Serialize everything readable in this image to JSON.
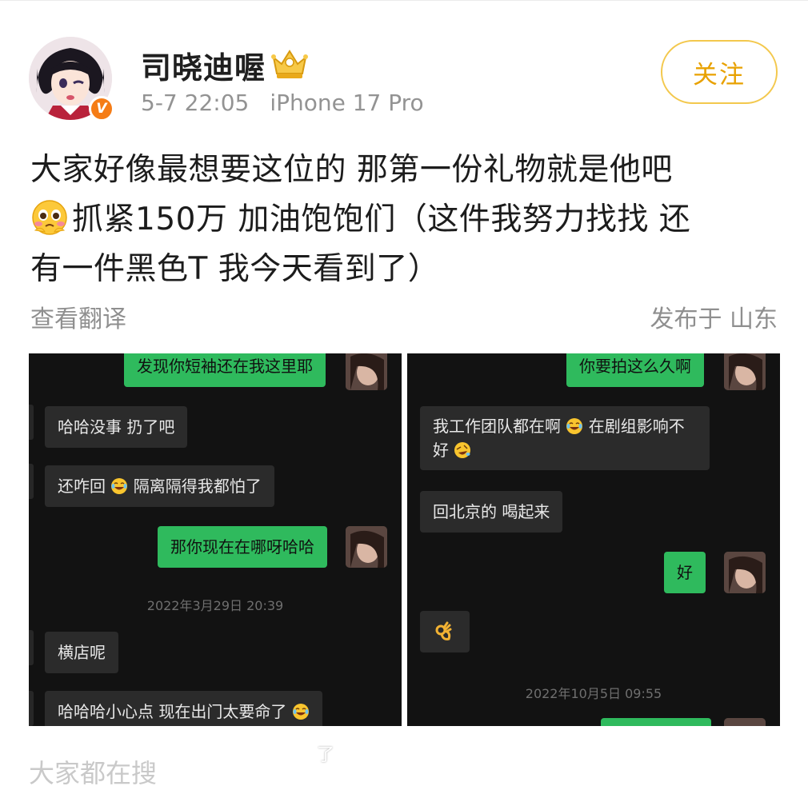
{
  "user": {
    "name": "司晓迪喔",
    "verified": "V",
    "time": "5-7 22:05",
    "device": "iPhone 17 Pro"
  },
  "follow_label": "关注",
  "post": {
    "line1": "大家好像最想要这位的 那第一份礼物就是他吧",
    "line2": "抓紧150万 加油饱饱们（这件我努力找找 还",
    "line3": "有一件黑色T 我今天看到了）"
  },
  "translate_label": "查看翻译",
  "location_label": "发布于 山东",
  "chat_left": {
    "msg1": "发现你短袖还在我这里耶",
    "msg2": "哈哈没事 扔了吧",
    "msg3a": "还咋回",
    "msg3b": "隔离隔得我都怕了",
    "msg4": "那你现在在哪呀哈哈",
    "timestamp": "2022年3月29日 20:39",
    "msg5": "横店呢",
    "msg6": "哈哈哈小心点 现在出门太要命了"
  },
  "chat_right": {
    "msg1": "你要拍这么久啊",
    "msg2a": "我工作团队都在啊",
    "msg2b": "在剧组影响不",
    "msg2c": "好",
    "msg3": "回北京的 喝起来",
    "msg4": "好",
    "timestamp": "2022年10月5日 09:55"
  },
  "footer_text": "大家都在搜",
  "watermark": "了",
  "colors": {
    "accent": "#e8a100",
    "follow_border": "#f3c84d",
    "chat_outgoing": "#2fba5d",
    "chat_incoming": "#2b2b2b",
    "chat_bg": "#121212"
  }
}
